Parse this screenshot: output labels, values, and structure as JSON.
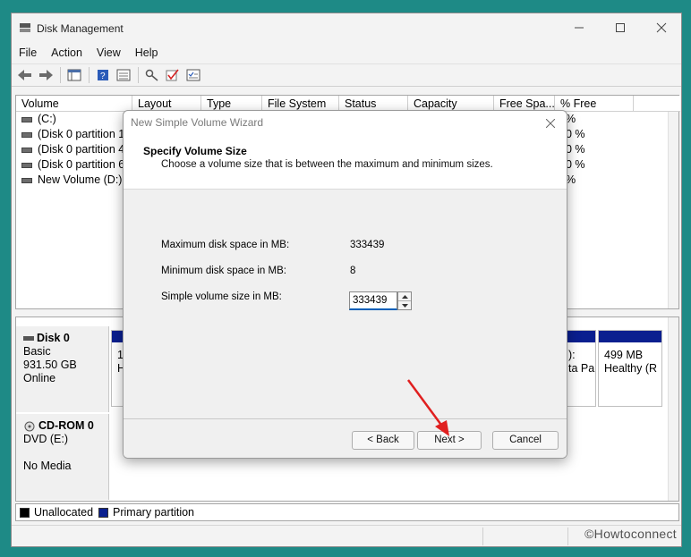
{
  "window": {
    "title": "Disk Management"
  },
  "menu": [
    "File",
    "Action",
    "View",
    "Help"
  ],
  "columns": [
    "Volume",
    "Layout",
    "Type",
    "File System",
    "Status",
    "Capacity",
    "Free Spa...",
    "% Free"
  ],
  "volumes": [
    {
      "name": "(C:)",
      "pct": "%"
    },
    {
      "name": "(Disk 0 partition 1)",
      "pct": "0 %"
    },
    {
      "name": "(Disk 0 partition 4)",
      "pct": "0 %"
    },
    {
      "name": "(Disk 0 partition 6)",
      "pct": "0 %"
    },
    {
      "name": "New Volume (D:)",
      "pct": "%"
    }
  ],
  "disks": [
    {
      "name": "Disk 0",
      "line1": "Basic",
      "line2": "931.50 GB",
      "line3": "Online"
    },
    {
      "name": "CD-ROM 0",
      "line1": "DVD (E:)",
      "line2": "",
      "line3": "No Media"
    }
  ],
  "partitions": {
    "left": {
      "line1": "1(",
      "line2": "H"
    },
    "mid": {
      "line1": "):",
      "line2": "ta Pa"
    },
    "right": {
      "line1": "499 MB",
      "line2": "Healthy (R"
    }
  },
  "legend": {
    "unallocated": "Unallocated",
    "primary": "Primary partition"
  },
  "watermark": "©Howtoconnect",
  "wizard": {
    "title": "New Simple Volume Wizard",
    "heading": "Specify Volume Size",
    "subheading": "Choose a volume size that is between the maximum and minimum sizes.",
    "max_label": "Maximum disk space in MB:",
    "max_value": "333439",
    "min_label": "Minimum disk space in MB:",
    "min_value": "8",
    "size_label": "Simple volume size in MB:",
    "size_value": "333439",
    "back": "< Back",
    "next": "Next >",
    "cancel": "Cancel"
  },
  "colors": {
    "teal_bg": "#1e8a86",
    "partition_blue": "#0a1f8f",
    "annotation_red": "#e01f1f"
  }
}
